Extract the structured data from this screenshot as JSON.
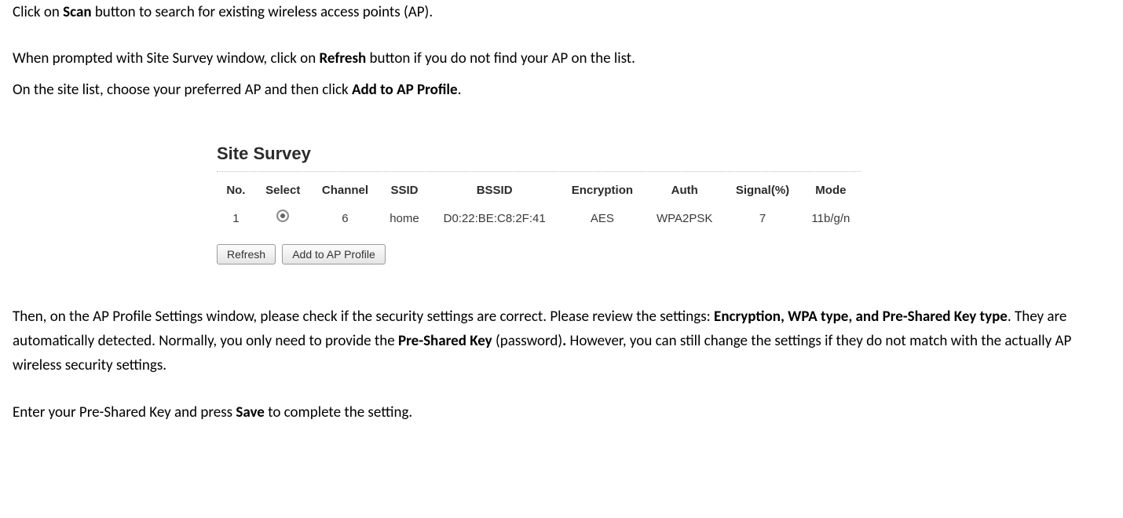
{
  "intro": {
    "line1_pre": "Click on ",
    "line1_bold": "Scan",
    "line1_post": " button to search for existing wireless access points (AP).",
    "line2_pre": "When prompted with Site Survey window, click on ",
    "line2_bold": "Refresh",
    "line2_post": " button if you do not find your AP on the list.",
    "line3_pre": "On the site list, choose your preferred AP and then click ",
    "line3_bold": "Add to AP Profile",
    "line3_post": "."
  },
  "site_survey": {
    "title": "Site Survey",
    "headers": {
      "no": "No.",
      "select": "Select",
      "channel": "Channel",
      "ssid": "SSID",
      "bssid": "BSSID",
      "encryption": "Encryption",
      "auth": "Auth",
      "signal": "Signal(%)",
      "mode": "Mode"
    },
    "row": {
      "no": "1",
      "channel": "6",
      "ssid": "home",
      "bssid": "D0:22:BE:C8:2F:41",
      "encryption": "AES",
      "auth": "WPA2PSK",
      "signal": "7",
      "mode": "11b/g/n"
    },
    "buttons": {
      "refresh": "Refresh",
      "add": "Add to AP Profile"
    }
  },
  "outro": {
    "p1_seg1": "Then, on the AP Profile Settings window, please check if the security settings are correct. Please review the settings: ",
    "p1_bold1": "Encryption, WPA type, and Pre-Shared Key type",
    "p1_seg2": ". They are automatically detected. Normally, you only need to provide the ",
    "p1_bold2": "Pre-Shared Key",
    "p1_seg3": " (password)",
    "p1_bold3": ".",
    "p1_seg4": " However, you can still change the settings if they do not match with the actually AP wireless security settings.",
    "p2_seg1": "Enter your Pre-Shared Key and press ",
    "p2_bold": "Save",
    "p2_seg2": " to complete the setting."
  }
}
